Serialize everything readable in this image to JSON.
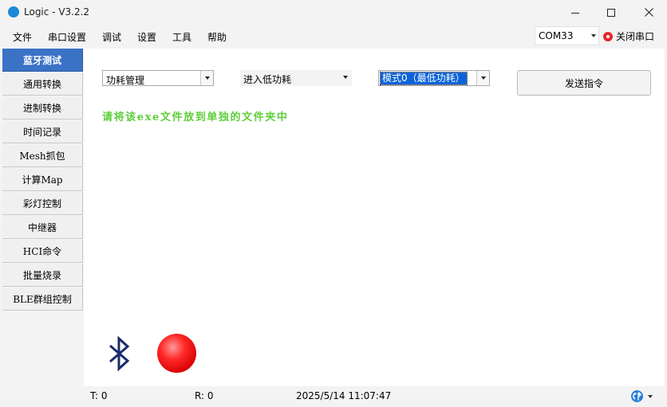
{
  "window": {
    "title": "Logic - V3.2.2"
  },
  "menu": [
    "文件",
    "串口设置",
    "调试",
    "设置",
    "工具",
    "帮助"
  ],
  "port": {
    "selected": "COM33",
    "close_label": "关闭串口"
  },
  "sidebar": {
    "items": [
      {
        "label": "蓝牙测试",
        "active": true
      },
      {
        "label": "通用转换"
      },
      {
        "label": "进制转换"
      },
      {
        "label": "时间记录"
      },
      {
        "label": "Mesh抓包"
      },
      {
        "label": "计算Map"
      },
      {
        "label": "彩灯控制"
      },
      {
        "label": "中继器"
      },
      {
        "label": "HCI命令"
      },
      {
        "label": "批量烧录"
      },
      {
        "label": "BLE群组控制"
      }
    ]
  },
  "main": {
    "category_select": "功耗管理",
    "action_select": "进入低功耗",
    "mode_select": "模式0（最低功耗）",
    "send_label": "发送指令",
    "notice": "请将该exe文件放到单独的文件夹中"
  },
  "status": {
    "tx": "T:  0",
    "rx": "R:  0",
    "datetime": "2025/5/14 11:07:47"
  },
  "icons": {
    "bluetooth": "bluetooth-icon",
    "led": "connection-status-led",
    "globe": "globe-icon"
  },
  "colors": {
    "accent": "#3a72c6",
    "notice": "#5fce3a",
    "led": "#e81818",
    "bluetooth": "#1a2a6c"
  }
}
